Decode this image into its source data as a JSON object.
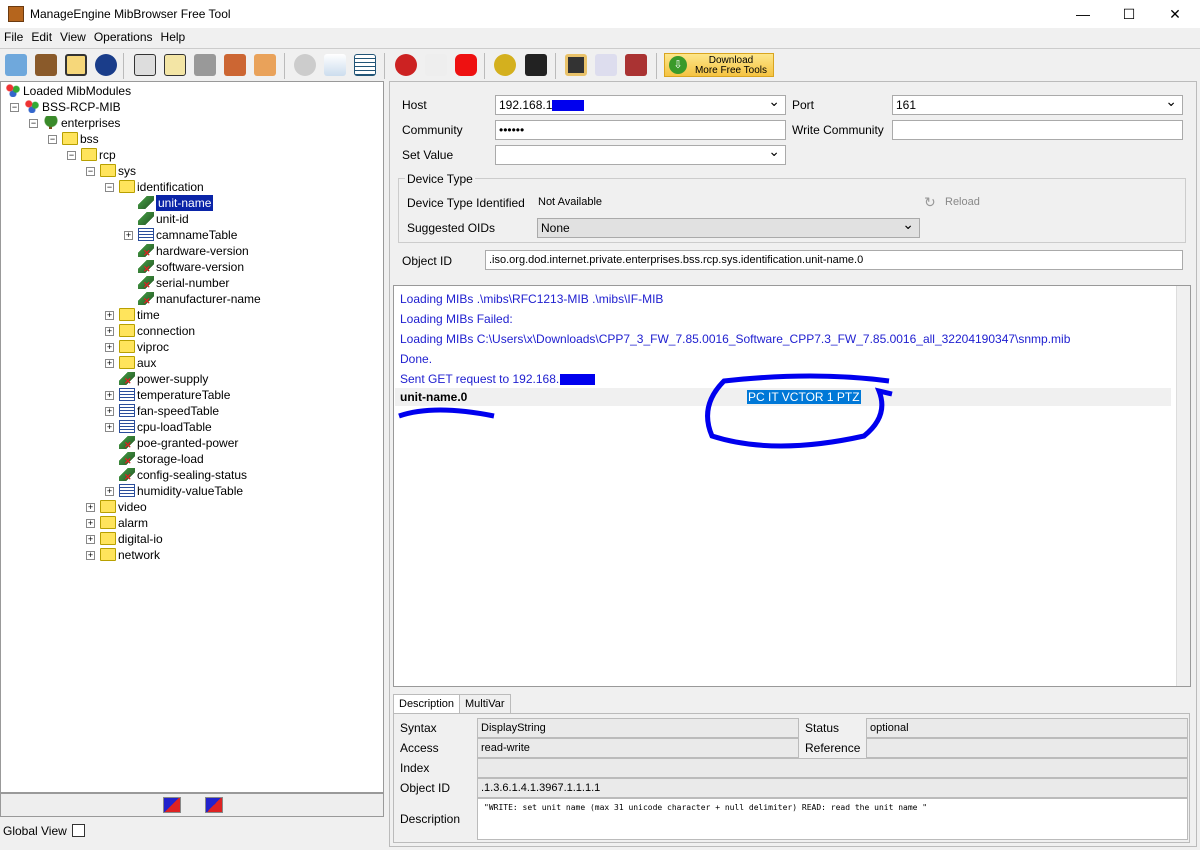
{
  "window": {
    "title": "ManageEngine MibBrowser Free Tool",
    "minimize": "—",
    "maximize": "☐",
    "close": "✕"
  },
  "menu": [
    "File",
    "Edit",
    "View",
    "Operations",
    "Help"
  ],
  "toolbar": {
    "download_line1": "Download",
    "download_line2": "More Free Tools",
    "download_icon": "⇩"
  },
  "tree": [
    {
      "label": "Loaded MibModules",
      "depth": 0,
      "icon": "mod",
      "exp": ""
    },
    {
      "label": "BSS-RCP-MIB",
      "depth": 1,
      "icon": "mod",
      "exp": "-"
    },
    {
      "label": "enterprises",
      "depth": 2,
      "icon": "tree",
      "exp": "-"
    },
    {
      "label": "bss",
      "depth": 3,
      "icon": "folder",
      "exp": "-"
    },
    {
      "label": "rcp",
      "depth": 4,
      "icon": "folder",
      "exp": "-"
    },
    {
      "label": "sys",
      "depth": 5,
      "icon": "folder",
      "exp": "-"
    },
    {
      "label": "identification",
      "depth": 6,
      "icon": "folder",
      "exp": "-"
    },
    {
      "label": "unit-name",
      "depth": 7,
      "icon": "leaf",
      "exp": "",
      "selected": true
    },
    {
      "label": "unit-id",
      "depth": 7,
      "icon": "leaf",
      "exp": ""
    },
    {
      "label": "camnameTable",
      "depth": 7,
      "icon": "table",
      "exp": "+"
    },
    {
      "label": "hardware-version",
      "depth": 7,
      "icon": "leafx",
      "exp": ""
    },
    {
      "label": "software-version",
      "depth": 7,
      "icon": "leafx",
      "exp": ""
    },
    {
      "label": "serial-number",
      "depth": 7,
      "icon": "leafx",
      "exp": ""
    },
    {
      "label": "manufacturer-name",
      "depth": 7,
      "icon": "leafx",
      "exp": ""
    },
    {
      "label": "time",
      "depth": 6,
      "icon": "folder",
      "exp": "+"
    },
    {
      "label": "connection",
      "depth": 6,
      "icon": "folder",
      "exp": "+"
    },
    {
      "label": "viproc",
      "depth": 6,
      "icon": "folder",
      "exp": "+"
    },
    {
      "label": "aux",
      "depth": 6,
      "icon": "folder",
      "exp": "+"
    },
    {
      "label": "power-supply",
      "depth": 6,
      "icon": "leafx",
      "exp": ""
    },
    {
      "label": "temperatureTable",
      "depth": 6,
      "icon": "table",
      "exp": "+"
    },
    {
      "label": "fan-speedTable",
      "depth": 6,
      "icon": "table",
      "exp": "+"
    },
    {
      "label": "cpu-loadTable",
      "depth": 6,
      "icon": "table",
      "exp": "+"
    },
    {
      "label": "poe-granted-power",
      "depth": 6,
      "icon": "leafx",
      "exp": ""
    },
    {
      "label": "storage-load",
      "depth": 6,
      "icon": "leafx",
      "exp": ""
    },
    {
      "label": "config-sealing-status",
      "depth": 6,
      "icon": "leafx",
      "exp": ""
    },
    {
      "label": "humidity-valueTable",
      "depth": 6,
      "icon": "table",
      "exp": "+"
    },
    {
      "label": "video",
      "depth": 5,
      "icon": "folder",
      "exp": "+"
    },
    {
      "label": "alarm",
      "depth": 5,
      "icon": "folder",
      "exp": "+"
    },
    {
      "label": "digital-io",
      "depth": 5,
      "icon": "folder",
      "exp": "+"
    },
    {
      "label": "network",
      "depth": 5,
      "icon": "folder",
      "exp": "+"
    }
  ],
  "global_view": "Global View",
  "form": {
    "host_label": "Host",
    "host": "192.168.1",
    "port_label": "Port",
    "port": "161",
    "community_label": "Community",
    "community": "••••••",
    "write_community_label": "Write Community",
    "write_community": "",
    "set_value_label": "Set Value",
    "set_value": "",
    "device_type_legend": "Device Type",
    "device_type_identified_label": "Device Type Identified",
    "device_type_identified": "Not Available",
    "reload": "Reload",
    "suggested_oids_label": "Suggested OIDs",
    "suggested_oids": "None",
    "object_id_label": "Object ID",
    "object_id": ".iso.org.dod.internet.private.enterprises.bss.rcp.sys.identification.unit-name.0"
  },
  "output": {
    "lines": [
      "Loading MIBs .\\mibs\\RFC1213-MIB .\\mibs\\IF-MIB",
      "Loading MIBs Failed:",
      "Loading MIBs C:\\Users\\x\\Downloads\\CPP7_3_FW_7.85.0016_Software_CPP7.3_FW_7.85.0016_all_32204190347\\snmp.mib",
      "Done.",
      "Sent GET request to 192.168.      : 161"
    ],
    "result_name": "unit-name.0",
    "result_value": "PC IT VCTOR 1 PTZ"
  },
  "tabs": [
    "Description",
    "MultiVar"
  ],
  "details": {
    "syntax_label": "Syntax",
    "syntax": "DisplayString",
    "status_label": "Status",
    "status": "optional",
    "access_label": "Access",
    "access": "read-write",
    "reference_label": "Reference",
    "reference": "",
    "index_label": "Index",
    "index": "",
    "object_id_label": "Object ID",
    "object_id": ".1.3.6.1.4.1.3967.1.1.1.1",
    "description_label": "Description",
    "description": "\"WRITE: set unit name (max 31 unicode character + null delimiter) READ: read the unit name \""
  },
  "colors": {
    "log": "#2020d0",
    "selection": "#0a24a8",
    "annotation": "#0000ee"
  }
}
